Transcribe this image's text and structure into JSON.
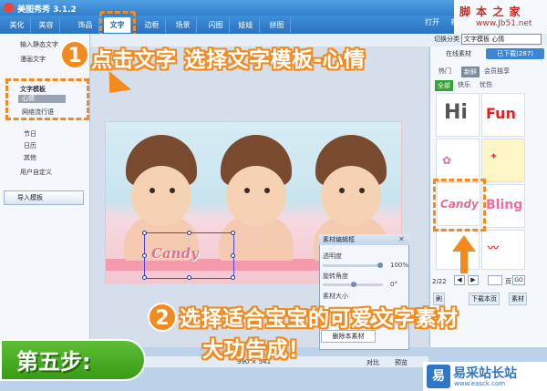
{
  "app": {
    "title": "美图秀秀 3.1.2"
  },
  "nav": {
    "tabs": [
      "美化",
      "美容",
      "饰品",
      "文字",
      "边框",
      "场景",
      "闪图",
      "娃娃",
      "拼图"
    ],
    "active": "文字"
  },
  "topright": {
    "open": "打开",
    "new": "新"
  },
  "watermark_top": {
    "line1": "脚 本 之 家",
    "line2": "www.Jb51.net"
  },
  "toolbar": {
    "category_label": "切换分类",
    "category_value": "文字模板 心情"
  },
  "leftpanel": {
    "items": [
      "输入静态文字",
      "漫画文字",
      "文字模板",
      "心情",
      "网络流行语",
      "节日",
      "日历",
      "其他",
      "用户自定义"
    ],
    "import_button": "导入模板"
  },
  "canvas": {
    "sticker_text": "Candy",
    "dimensions": "990 × 541",
    "compare": "对比",
    "preview": "预览"
  },
  "dialog": {
    "title": "素材编辑框",
    "opacity_label": "透明度",
    "opacity_value": "100%",
    "rotation_label": "旋转角度",
    "rotation_value": "0°",
    "size_label": "素材大小",
    "delete_button": "删除本素材"
  },
  "rightpanel": {
    "tab_online": "在线素材",
    "tab_downloaded": "已下载(287)",
    "subtabs": [
      "热门",
      "新鲜",
      "会员独享"
    ],
    "filters": [
      "全部",
      "快乐",
      "忧伤"
    ],
    "thumb_texts": [
      "Hi",
      "Fun",
      "Bling",
      "Candy",
      "Bling"
    ],
    "page_label": "2/22",
    "page_unit": "页",
    "go": "GO",
    "bottom": [
      "刷",
      "下载本页",
      "素材"
    ]
  },
  "annotations": {
    "step1_num": "1",
    "step1_text": "点击文字 选择文字模板-心情",
    "step2_num": "2",
    "step2_text_line1": "选择适合宝宝的可爱文字素材",
    "step2_text_line2": "大功告成！",
    "step_label": "第五步:"
  },
  "watermark_bottom": {
    "name": "易采站长站",
    "url": "www.easck.com",
    "logo_text": "易"
  },
  "colors": {
    "accent": "#f28a1d",
    "titlebar": "#2f7fd0",
    "step_green": "#399c16"
  }
}
